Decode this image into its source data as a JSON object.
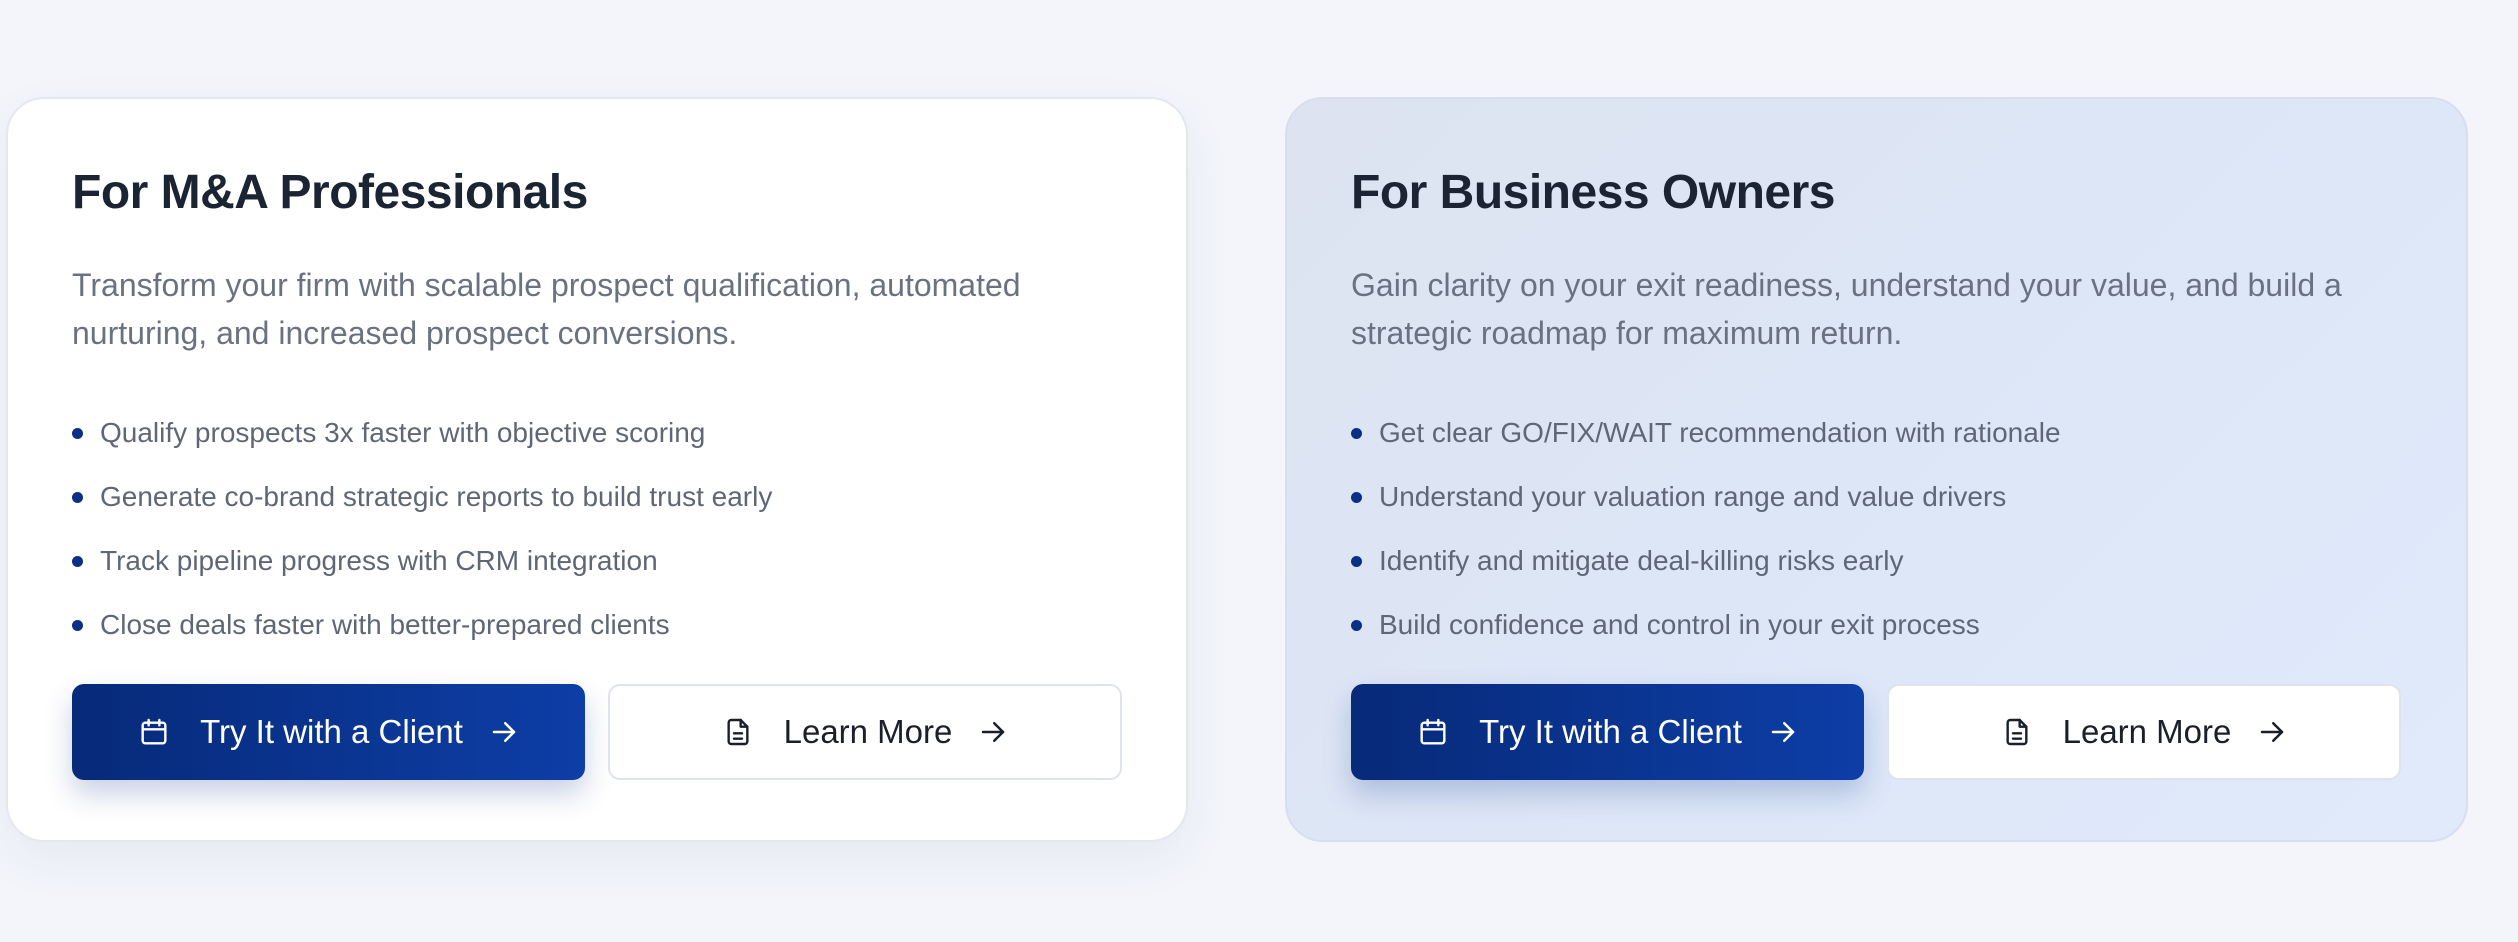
{
  "left_card": {
    "title": "For M&A Professionals",
    "description": "Transform your firm with scalable prospect qualification, automated nurturing, and increased prospect conversions.",
    "bullets": [
      "Qualify prospects 3x faster with objective scoring",
      "Generate co-brand strategic reports to build trust early",
      "Track pipeline progress with CRM integration",
      "Close deals faster with better-prepared clients"
    ],
    "primary_button": {
      "label": "Try It with a Client",
      "icon": "calendar-icon",
      "trailing_icon": "arrow-right-icon"
    },
    "secondary_button": {
      "label": "Learn More",
      "icon": "document-icon",
      "trailing_icon": "arrow-right-icon"
    }
  },
  "right_card": {
    "title": "For Business Owners",
    "description": "Gain clarity on your exit readiness, understand your value, and build a strategic roadmap for maximum return.",
    "bullets": [
      "Get clear GO/FIX/WAIT recommendation with rationale",
      "Understand your valuation range and value drivers",
      "Identify and mitigate deal-killing risks early",
      "Build confidence and control in your exit process"
    ],
    "primary_button": {
      "label": "Try It with a Client",
      "icon": "calendar-icon",
      "trailing_icon": "arrow-right-icon"
    },
    "secondary_button": {
      "label": "Learn More",
      "icon": "document-icon",
      "trailing_icon": "arrow-right-icon"
    }
  },
  "colors": {
    "page_background": "#f3f5fb",
    "primary_button_start": "#072a79",
    "primary_button_end": "#0d3ea6",
    "bullet_dot": "#0a2f86",
    "heading_text": "#1b2433",
    "body_text": "#6a7281"
  }
}
